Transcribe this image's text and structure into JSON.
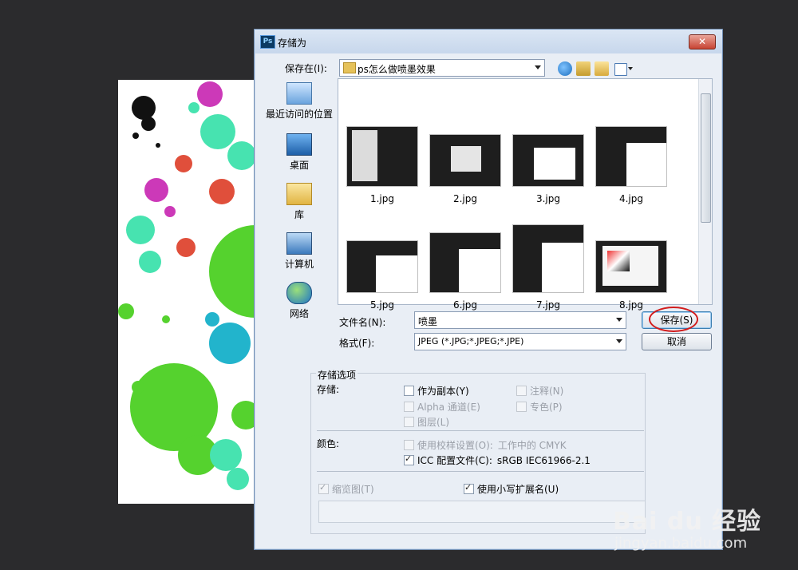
{
  "dialog": {
    "title": "存储为",
    "app_icon_text": "Ps",
    "close_glyph": "✕"
  },
  "location": {
    "label": "保存在(I):",
    "folder": "ps怎么做喷墨效果"
  },
  "places": [
    {
      "label": "最近访问的位置",
      "icon": "recent-places-icon"
    },
    {
      "label": "桌面",
      "icon": "desktop-icon"
    },
    {
      "label": "库",
      "icon": "libraries-icon"
    },
    {
      "label": "计算机",
      "icon": "computer-icon"
    },
    {
      "label": "网络",
      "icon": "network-icon"
    }
  ],
  "files": [
    {
      "name": "1.jpg"
    },
    {
      "name": "2.jpg"
    },
    {
      "name": "3.jpg"
    },
    {
      "name": "4.jpg"
    },
    {
      "name": "5.jpg"
    },
    {
      "name": "6.jpg"
    },
    {
      "name": "7.jpg"
    },
    {
      "name": "8.jpg"
    }
  ],
  "filename": {
    "label": "文件名(N):",
    "value": "喷墨"
  },
  "format": {
    "label": "格式(F):",
    "value": "JPEG (*.JPG;*.JPEG;*.JPE)"
  },
  "buttons": {
    "save": "保存(S)",
    "cancel": "取消"
  },
  "save_options": {
    "title": "存储选项",
    "storage_label": "存储:",
    "as_copy": "作为副本(Y)",
    "notes": "注释(N)",
    "alpha": "Alpha 通道(E)",
    "spot": "专色(P)",
    "layers": "图层(L)",
    "color_label": "颜色:",
    "proof": "使用校样设置(O):",
    "proof_value": "工作中的 CMYK",
    "icc": "ICC 配置文件(C):",
    "icc_value": "sRGB IEC61966-2.1",
    "thumbnail": "缩览图(T)",
    "lowercase": "使用小写扩展名(U)"
  },
  "watermark": {
    "logo": "Bai du 经验",
    "url": "jingyan.baidu.com"
  },
  "colors": {
    "accent_red": "#d21c1c",
    "dialog_bg": "#e9eef5",
    "desktop_bg": "#2b2b2d"
  }
}
